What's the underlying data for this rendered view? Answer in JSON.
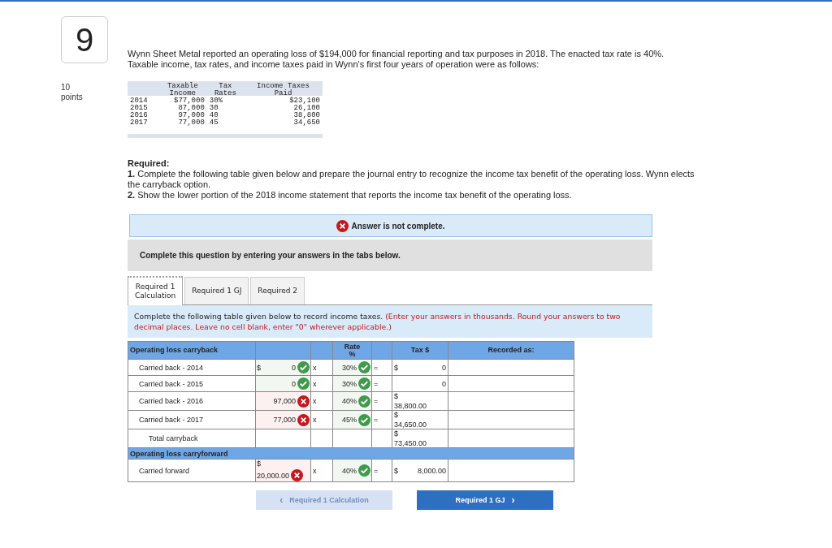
{
  "question": {
    "number": "9",
    "points_value": "10",
    "points_label": "points",
    "text": "Wynn Sheet Metal reported an operating loss of $194,000 for financial reporting and tax purposes in 2018. The enacted tax rate is 40%. Taxable income, tax rates, and income taxes paid in Wynn's first four years of operation were as follows:"
  },
  "data_table": {
    "columns": [
      "",
      "Taxable\nIncome",
      "Tax\nRates",
      "Income Taxes\nPaid"
    ],
    "rows": [
      [
        "2014",
        "$77,000",
        "30%",
        "$23,100"
      ],
      [
        "2015",
        "87,000",
        "30",
        "26,100"
      ],
      [
        "2016",
        "97,000",
        "40",
        "38,800"
      ],
      [
        "2017",
        "77,000",
        "45",
        "34,650"
      ]
    ]
  },
  "required": {
    "heading": "Required:",
    "items": [
      "**1.** Complete the following table given below and prepare the journal entry to recognize the income tax benefit of the operating loss. Wynn elects the carryback option.",
      "**2.** Show the lower portion of the 2018 income statement that reports the income tax benefit of the operating loss."
    ]
  },
  "answer_status": {
    "text": "Answer is not complete.",
    "complete": false
  },
  "prompt": "Complete this question by entering your answers in the tabs below.",
  "tabs": [
    {
      "label": "Required 1\nCalculation",
      "selected": true
    },
    {
      "label": "Required 1 GJ",
      "selected": false
    },
    {
      "label": "Required 2",
      "selected": false
    }
  ],
  "instruction": {
    "text": "Complete the following table given below to record income taxes.",
    "note": "(Enter your answers in thousands. Round your answers to two decimal places. Leave no cell blank, enter \"0\" wherever applicable.)"
  },
  "table": {
    "columns": [
      "Operating loss carryback",
      "",
      "",
      "Rate\n%",
      "",
      "Tax $",
      "Recorded as:"
    ],
    "rows": [
      {
        "kind": "entry",
        "label": "Carried back - 2014",
        "amount": {
          "currency": "$",
          "value": "0",
          "correct": true,
          "stacked": false
        },
        "operator": "x",
        "rate": {
          "value": "30%",
          "correct": true
        },
        "equals": "=",
        "tax": {
          "currency": "$",
          "value": "0",
          "stacked": false
        }
      },
      {
        "kind": "entry",
        "label": "Carried back - 2015",
        "amount": {
          "value": "0",
          "correct": true,
          "stacked": false
        },
        "operator": "x",
        "rate": {
          "value": "30%",
          "correct": true
        },
        "equals": "=",
        "tax": {
          "value": "0",
          "stacked": false
        }
      },
      {
        "kind": "entry",
        "label": "Carried back - 2016",
        "amount": {
          "value": "97,000",
          "correct": false,
          "stacked": false
        },
        "operator": "x",
        "rate": {
          "value": "40%",
          "correct": true
        },
        "equals": "=",
        "tax": {
          "currency": "$",
          "value": "38,800.00",
          "stacked": true
        }
      },
      {
        "kind": "entry",
        "label": "Carried back - 2017",
        "amount": {
          "value": "77,000",
          "correct": false,
          "stacked": false
        },
        "operator": "x",
        "rate": {
          "value": "45%",
          "correct": true
        },
        "equals": "=",
        "tax": {
          "currency": "$",
          "value": "34,650.00",
          "stacked": true
        }
      },
      {
        "kind": "total",
        "label": "Total carryback",
        "tax": {
          "currency": "$",
          "value": "73,450.00",
          "stacked": true
        }
      },
      {
        "kind": "section",
        "label": "Operating loss carryforward"
      },
      {
        "kind": "entry",
        "label": "Carried forward",
        "amount": {
          "currency": "$",
          "value": "20,000.00",
          "correct": false,
          "stacked": true
        },
        "operator": "x",
        "rate": {
          "value": "40%",
          "correct": true
        },
        "equals": "=",
        "tax": {
          "currency": "$",
          "value": "8,000.00",
          "stacked": false
        }
      }
    ]
  },
  "navigation": [
    {
      "label": "Required 1 Calculation",
      "arrow": "‹",
      "kind": "previous",
      "disabled": true
    },
    {
      "label": "Required 1 GJ",
      "arrow": "›",
      "kind": "next",
      "disabled": false
    }
  ]
}
